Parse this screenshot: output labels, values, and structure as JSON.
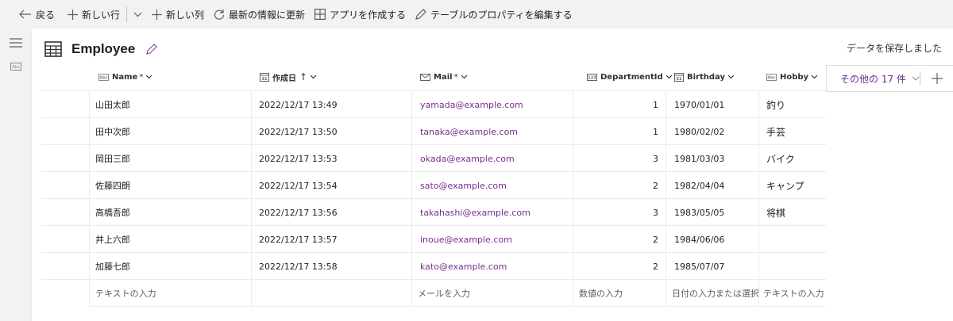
{
  "toolbar": {
    "back": "戻る",
    "new_row": "新しい行",
    "new_column": "新しい列",
    "refresh": "最新の情報に更新",
    "create_app": "アプリを作成する",
    "edit_properties": "テーブルのプロパティを編集する"
  },
  "header": {
    "table_name": "Employee",
    "save_status": "データを保存しました"
  },
  "columns": [
    {
      "label": "Name",
      "required": "*",
      "type_icon": "text-type-icon"
    },
    {
      "label": "作成日",
      "sort": "↑",
      "type_icon": "date-type-icon"
    },
    {
      "label": "Mail",
      "required": "*",
      "type_icon": "mail-type-icon"
    },
    {
      "label": "DepartmentId",
      "type_icon": "number-type-icon"
    },
    {
      "label": "Birthday",
      "type_icon": "date-type-icon"
    },
    {
      "label": "Hobby",
      "type_icon": "text-type-icon"
    }
  ],
  "more_columns": "その他の 17 件",
  "rows": [
    {
      "name": "山田太郎",
      "created": "2022/12/17 13:49",
      "mail": "yamada@example.com",
      "dept": "1",
      "birthday": "1970/01/01",
      "hobby": "釣り"
    },
    {
      "name": "田中次郎",
      "created": "2022/12/17 13:50",
      "mail": "tanaka@example.com",
      "dept": "1",
      "birthday": "1980/02/02",
      "hobby": "手芸"
    },
    {
      "name": "岡田三郎",
      "created": "2022/12/17 13:53",
      "mail": "okada@example.com",
      "dept": "3",
      "birthday": "1981/03/03",
      "hobby": "バイク"
    },
    {
      "name": "佐藤四朗",
      "created": "2022/12/17 13:54",
      "mail": "sato@example.com",
      "dept": "2",
      "birthday": "1982/04/04",
      "hobby": "キャンプ"
    },
    {
      "name": "高橋吾郎",
      "created": "2022/12/17 13:56",
      "mail": "takahashi@example.com",
      "dept": "3",
      "birthday": "1983/05/05",
      "hobby": "将棋"
    },
    {
      "name": "井上六郎",
      "created": "2022/12/17 13:57",
      "mail": "inoue@example.com",
      "dept": "2",
      "birthday": "1984/06/06",
      "hobby": ""
    },
    {
      "name": "加藤七郎",
      "created": "2022/12/17 13:58",
      "mail": "kato@example.com",
      "dept": "2",
      "birthday": "1985/07/07",
      "hobby": ""
    }
  ],
  "placeholders": {
    "name": "テキストの入力",
    "mail": "メールを入力",
    "dept": "数値の入力",
    "birthday": "日付の入力または選択",
    "hobby": "テキストの入力"
  },
  "colors": {
    "accent": "#6b2c8f",
    "mail_link": "#7b2f8f",
    "toolbar_bg": "#f3f2f1"
  }
}
